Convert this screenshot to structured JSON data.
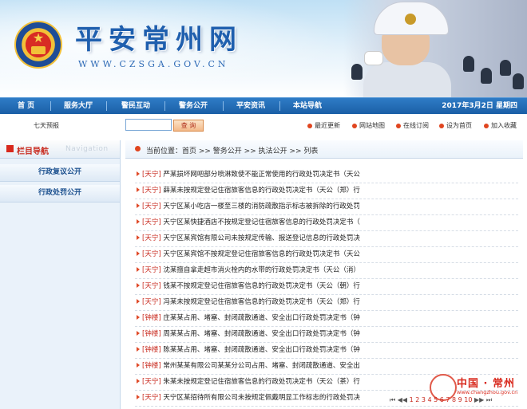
{
  "header": {
    "site_title": "平安常州网",
    "site_url": "WWW.CZSGA.GOV.CN"
  },
  "nav": {
    "items": [
      {
        "label": "首  页"
      },
      {
        "label": "服务大厅"
      },
      {
        "label": "警民互动"
      },
      {
        "label": "警务公开"
      },
      {
        "label": "平安资讯"
      },
      {
        "label": "本站导航"
      }
    ],
    "date": "2017年3月2日  星期四"
  },
  "toolbar": {
    "forecast": "七天预报",
    "search_placeholder": "",
    "search_button": "查 询",
    "links": [
      {
        "label": "最近更新"
      },
      {
        "label": "网站地图"
      },
      {
        "label": "在线订阅"
      },
      {
        "label": "设为首页"
      },
      {
        "label": "加入收藏"
      }
    ]
  },
  "sidebar": {
    "title": "栏目导航",
    "title_en": "Navigation",
    "items": [
      {
        "label": "行政复议公开"
      },
      {
        "label": "行政处罚公开"
      }
    ]
  },
  "breadcrumb": {
    "text": "当前位置：首页 >> 警务公开 >> 执法公开 >> 列表"
  },
  "list": {
    "items": [
      {
        "tag": "[天宁]",
        "title": "严某损坏网吧部分喷淋致使不能正常使用的行政处罚决定书（天公"
      },
      {
        "tag": "[天宁]",
        "title": "薛某未按规定登记住宿旅客信息的行政处罚决定书（天公（郑）行"
      },
      {
        "tag": "[天宁]",
        "title": "天宁区某小吃店一楼至三楼的消防疏散指示标志被拆除的行政处罚"
      },
      {
        "tag": "[天宁]",
        "title": "天宁区某快捷酒店不按规定登记住宿旅客信息的行政处罚决定书（"
      },
      {
        "tag": "[天宁]",
        "title": "天宁区某宾馆有限公司未按规定传输、报送登记信息的行政处罚决"
      },
      {
        "tag": "[天宁]",
        "title": "天宁区某宾馆不按规定登记住宿旅客信息的行政处罚决定书（天公"
      },
      {
        "tag": "[天宁]",
        "title": "沈某擅自拿走超市消火栓内的水带的行政处罚决定书（天公（消）"
      },
      {
        "tag": "[天宁]",
        "title": "钱某不按规定登记住宿旅客信息的行政处罚决定书（天公（朝）行"
      },
      {
        "tag": "[天宁]",
        "title": "冯某未按规定登记住宿旅客信息的行政处罚决定书（天公（郑）行"
      },
      {
        "tag": "[钟楼]",
        "title": "庄某某占用、堵塞、封闭疏散通道、安全出口行政处罚决定书（钟"
      },
      {
        "tag": "[钟楼]",
        "title": "周某某占用、堵塞、封闭疏散通道、安全出口行政处罚决定书（钟"
      },
      {
        "tag": "[钟楼]",
        "title": "陈某某占用、堵塞、封闭疏散通道、安全出口行政处罚决定书（钟"
      },
      {
        "tag": "[钟楼]",
        "title": "常州某某有限公司某某分公司占用、堵塞、封闭疏散通道、安全出"
      },
      {
        "tag": "[天宁]",
        "title": "朱某未按规定登记住宿旅客信息的行政处罚决定书（天公（茶）行"
      },
      {
        "tag": "[天宁]",
        "title": "天宁区某招待所有限公司未按规定佩戴明显工作标志的行政处罚决"
      }
    ]
  },
  "pager": {
    "first": "⏮",
    "prev": "◀◀",
    "pages": "1 2 3 4 5 6 7 8 9 10",
    "next": "▶▶",
    "last": "⏭"
  },
  "watermark": {
    "title": "中国 · 常州",
    "url": "www.changzhou.gov.cn"
  },
  "colors": {
    "nav_bg": "#1a5fa6",
    "accent_red": "#c8281c",
    "link_blue": "#1a4f8e"
  }
}
